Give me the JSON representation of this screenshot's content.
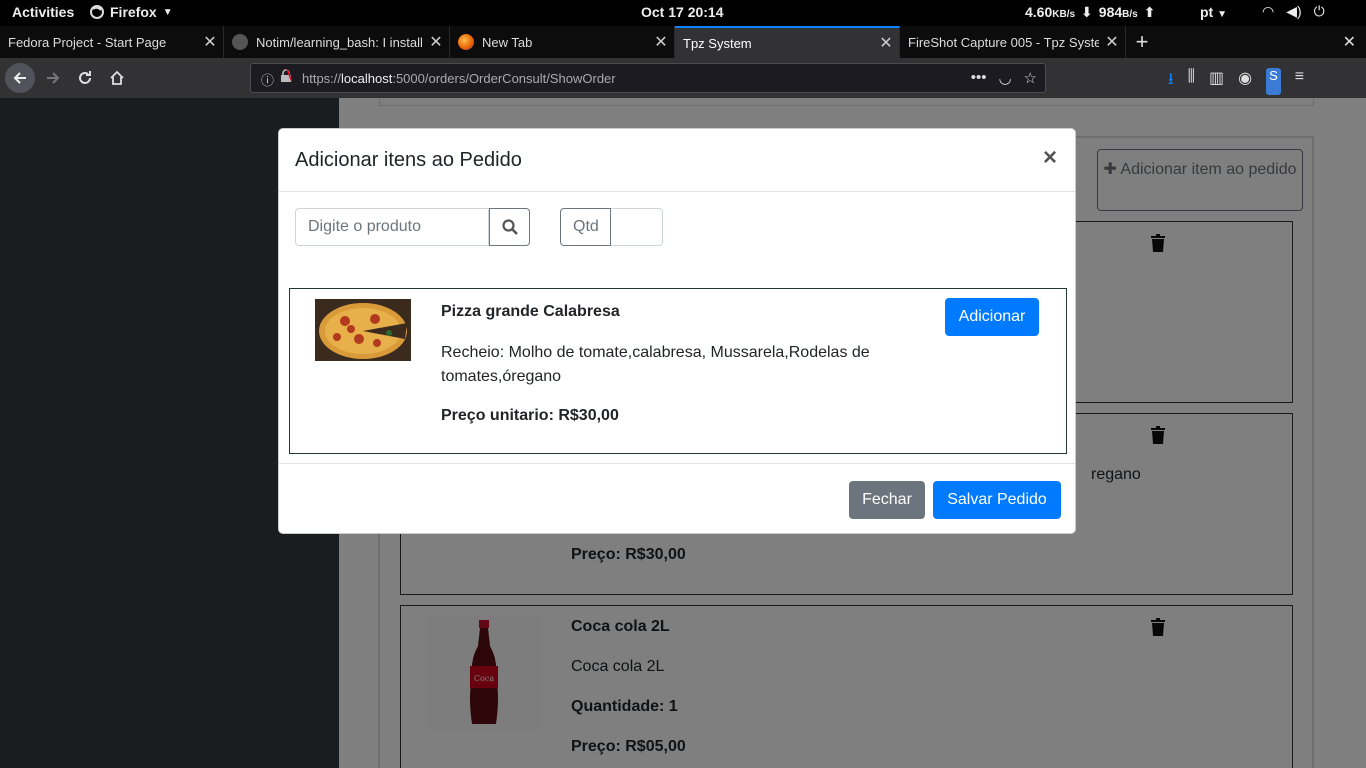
{
  "system_bar": {
    "activities": "Activities",
    "app_name": "Firefox",
    "clock": "Oct 17  20:14",
    "net_down_value": "4.60",
    "net_down_unit": "KB/s",
    "net_up_value": "984",
    "net_up_unit": "B/s",
    "language": "pt"
  },
  "tabs": [
    {
      "title": "Fedora Project - Start Page",
      "active": false
    },
    {
      "title": "Notim/learning_bash: I install",
      "active": false
    },
    {
      "title": "New Tab",
      "active": false
    },
    {
      "title": "Tpz System",
      "active": true
    },
    {
      "title": "FireShot Capture 005 - Tpz Syste",
      "active": false
    }
  ],
  "url": {
    "scheme": "https://",
    "host": "localhost",
    "path": ":5000/orders/OrderConsult/ShowOrder"
  },
  "background_page": {
    "add_item_button": "Adicionar item ao pedido",
    "items": [
      {
        "name": "",
        "description": "",
        "quantity": "",
        "price": ""
      },
      {
        "name": "",
        "description": "regano",
        "quantity": "",
        "price": "Preço: R$30,00"
      },
      {
        "name": "Coca cola 2L",
        "description": "Coca cola 2L",
        "quantity": "Quantidade: 1",
        "price": "Preço: R$05,00"
      }
    ]
  },
  "modal": {
    "title": "Adicionar itens ao Pedido",
    "close_symbol": "×",
    "search_placeholder": "Digite o produto",
    "qty_placeholder": "Qtd",
    "product": {
      "name": "Pizza grande Calabresa",
      "description": "Recheio: Molho de tomate,calabresa, Mussarela,Rodelas de tomates,óregano",
      "price": "Preço unitario: R$30,00",
      "add_label": "Adicionar"
    },
    "close_label": "Fechar",
    "save_label": "Salvar Pedido"
  },
  "colors": {
    "primary": "#007bff",
    "secondary": "#6c757d",
    "sidebar": "#343a40"
  }
}
